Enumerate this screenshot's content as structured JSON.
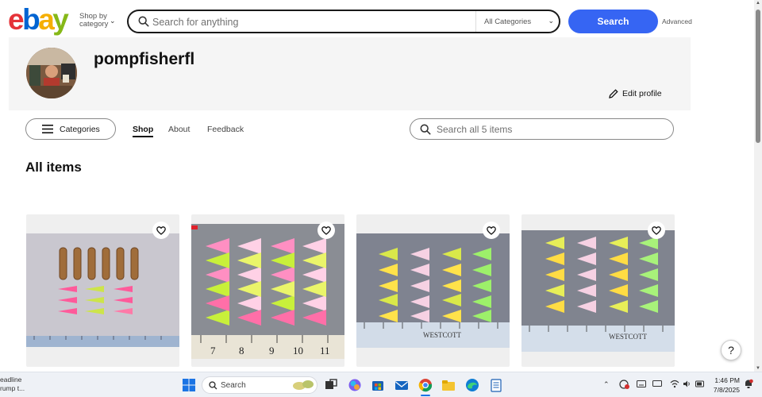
{
  "header": {
    "logo": [
      "e",
      "b",
      "a",
      "y"
    ],
    "logo_colors": [
      "#e53238",
      "#0064d2",
      "#f5af02",
      "#86b817"
    ],
    "shop_by_category": [
      "Shop by",
      "category"
    ],
    "search_placeholder": "Search for anything",
    "category_select": "All Categories",
    "search_button": "Search",
    "advanced_link": "Advanced"
  },
  "profile": {
    "username": "pompfisherfl",
    "edit_profile": "Edit profile"
  },
  "store_nav": {
    "categories_button": "Categories",
    "tabs": [
      {
        "label": "Shop",
        "active": true
      },
      {
        "label": "About",
        "active": false
      },
      {
        "label": "Feedback",
        "active": false
      }
    ],
    "store_search_placeholder": "Search all 5 items"
  },
  "main": {
    "section_title": "All items",
    "items_count_in_view": 4
  },
  "ruler_labels": {
    "card2": [
      "7",
      "8",
      "9",
      "10",
      "11"
    ],
    "brand": "WESTCOTT"
  },
  "help_button": "?",
  "taskbar": {
    "news_snippet": [
      "eadline",
      "rump t..."
    ],
    "search_label": "Search",
    "time": "1:46 PM",
    "date": "7/8/2025"
  },
  "colors": {
    "accent": "#3665f3",
    "card_bg": "#efefef",
    "banner_bg": "#f5f5f5"
  }
}
